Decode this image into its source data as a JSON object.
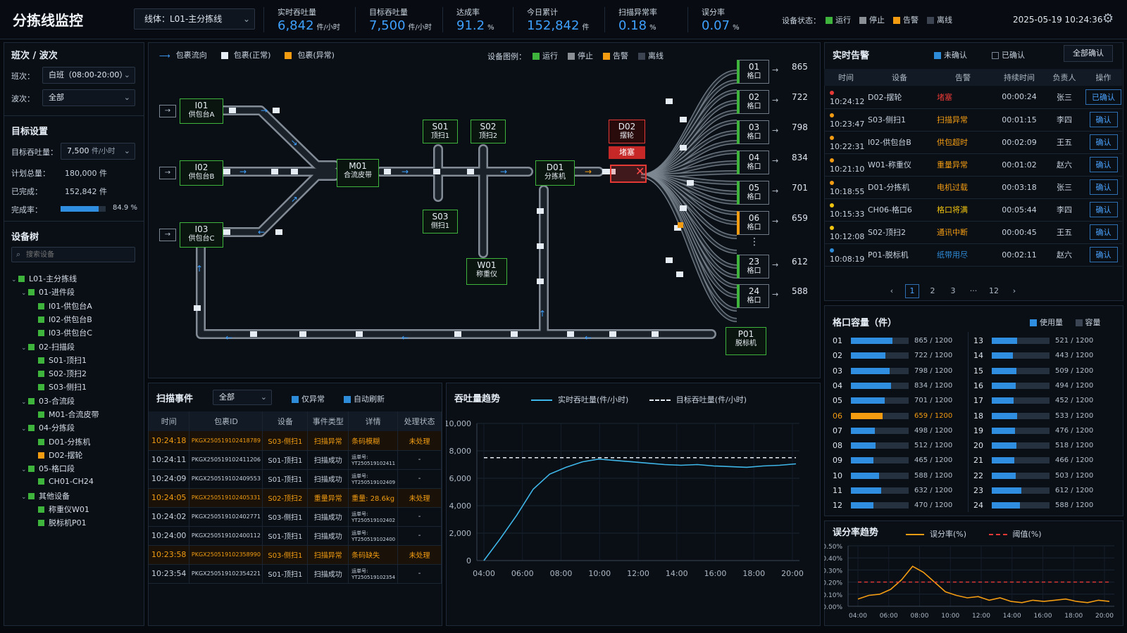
{
  "header": {
    "title": "分拣线监控",
    "line_select": "线体：L01-主分拣线",
    "datetime": "2025-05-19 10:24:36",
    "kpis": [
      {
        "label": "实时吞吐量",
        "value": "6,842",
        "unit": "件/小时"
      },
      {
        "label": "目标吞吐量",
        "value": "7,500",
        "unit": "件/小时"
      },
      {
        "label": "达成率",
        "value": "91.2",
        "unit": "%"
      },
      {
        "label": "今日累计",
        "value": "152,842",
        "unit": "件"
      },
      {
        "label": "扫描异常率",
        "value": "0.18",
        "unit": "%"
      },
      {
        "label": "误分率",
        "value": "0.07",
        "unit": "%"
      }
    ],
    "status_label": "设备状态：",
    "status": [
      {
        "label": "运行",
        "color": "#3eb43c"
      },
      {
        "label": "停止",
        "color": "#8a8f96"
      },
      {
        "label": "告警",
        "color": "#f39c12"
      },
      {
        "label": "离线",
        "color": "#3b4450"
      }
    ]
  },
  "left": {
    "shift_title": "班次 / 波次",
    "shift_label": "班次：",
    "shift_value": "白班（08:00-20:00）",
    "wave_label": "波次：",
    "wave_value": "全部",
    "target_title": "目标设置",
    "target_label": "目标吞吐量：",
    "target_value": "7,500",
    "target_unit": "件/小时",
    "plan_label": "计划总量：",
    "plan_value": "180,000 件",
    "done_label": "已完成：",
    "done_value": "152,842 件",
    "rate_label": "完成率：",
    "rate_value": "84.9 %",
    "rate": 0.849,
    "tree_title": "设备树",
    "search_placeholder": "搜索设备",
    "tree": [
      {
        "t": "L01-主分拣线",
        "lv": 0,
        "car": "⌄"
      },
      {
        "t": "01-进件段",
        "lv": 1,
        "car": "⌄"
      },
      {
        "t": "I01-供包台A",
        "lv": 2
      },
      {
        "t": "I02-供包台B",
        "lv": 2
      },
      {
        "t": "I03-供包台C",
        "lv": 2
      },
      {
        "t": "02-扫描段",
        "lv": 1,
        "car": "⌄"
      },
      {
        "t": "S01-顶扫1",
        "lv": 2
      },
      {
        "t": "S02-顶扫2",
        "lv": 2
      },
      {
        "t": "S03-侧扫1",
        "lv": 2
      },
      {
        "t": "03-合流段",
        "lv": 1,
        "car": "⌄"
      },
      {
        "t": "M01-合流皮带",
        "lv": 2
      },
      {
        "t": "04-分拣段",
        "lv": 1,
        "car": "⌄"
      },
      {
        "t": "D01-分拣机",
        "lv": 2
      },
      {
        "t": "D02-摆轮",
        "lv": 2,
        "warn": true
      },
      {
        "t": "05-格口段",
        "lv": 1,
        "car": "⌄"
      },
      {
        "t": "CH01-CH24",
        "lv": 2
      },
      {
        "t": "其他设备",
        "lv": 1,
        "car": "⌄"
      },
      {
        "t": "称重仪W01",
        "lv": 2
      },
      {
        "t": "脱标机P01",
        "lv": 2
      }
    ]
  },
  "flow": {
    "legend": [
      {
        "label": "包裹流向",
        "kind": "arrow"
      },
      {
        "label": "包裹(正常)",
        "kind": "white"
      },
      {
        "label": "包裹(异常)",
        "kind": "orange"
      }
    ],
    "dev_legend_label": "设备图例：",
    "dev_legend": [
      "运行",
      "停止",
      "告警",
      "离线"
    ],
    "nodes": [
      {
        "id": "I01",
        "name": "供包台A"
      },
      {
        "id": "I02",
        "name": "供包台B"
      },
      {
        "id": "I03",
        "name": "供包台C"
      },
      {
        "id": "M01",
        "name": "合流皮带"
      },
      {
        "id": "S01",
        "name": "顶扫1"
      },
      {
        "id": "S02",
        "name": "顶扫2"
      },
      {
        "id": "S03",
        "name": "侧扫1"
      },
      {
        "id": "W01",
        "name": "称重仪"
      },
      {
        "id": "D01",
        "name": "分拣机"
      },
      {
        "id": "D02",
        "name": "摆轮"
      },
      {
        "id": "P01",
        "name": "脱标机"
      }
    ],
    "jam_label": "堵塞",
    "chutes": [
      {
        "id": "01",
        "name": "格口",
        "count": "865"
      },
      {
        "id": "02",
        "name": "格口",
        "count": "722"
      },
      {
        "id": "03",
        "name": "格口",
        "count": "798"
      },
      {
        "id": "04",
        "name": "格口",
        "count": "834"
      },
      {
        "id": "05",
        "name": "格口",
        "count": "701"
      },
      {
        "id": "06",
        "name": "格口",
        "count": "659",
        "warn": true
      },
      {
        "id": "23",
        "name": "格口",
        "count": "612"
      },
      {
        "id": "24",
        "name": "格口",
        "count": "588"
      }
    ],
    "more": "⋮"
  },
  "alarms": {
    "title": "实时告警",
    "unack": "未确认",
    "ack": "已确认",
    "ack_all": "全部确认",
    "headers": [
      "时间",
      "设备",
      "告警",
      "持续时间",
      "负责人",
      "操作"
    ],
    "rows": [
      {
        "dot": "#e53935",
        "time": "10:24:12",
        "dev": "D02-摆轮",
        "alarm": "堵塞",
        "acolor": "#e53935",
        "dur": "00:00:24",
        "owner": "张三",
        "op": "已确认"
      },
      {
        "dot": "#f39c12",
        "time": "10:23:47",
        "dev": "S03-侧扫1",
        "alarm": "扫描异常",
        "acolor": "#f39c12",
        "dur": "00:01:15",
        "owner": "李四",
        "op": "确认"
      },
      {
        "dot": "#f39c12",
        "time": "10:22:31",
        "dev": "I02-供包台B",
        "alarm": "供包超时",
        "acolor": "#f39c12",
        "dur": "00:02:09",
        "owner": "王五",
        "op": "确认"
      },
      {
        "dot": "#f39c12",
        "time": "10:21:10",
        "dev": "W01-称重仪",
        "alarm": "重量异常",
        "acolor": "#f39c12",
        "dur": "00:01:02",
        "owner": "赵六",
        "op": "确认"
      },
      {
        "dot": "#f39c12",
        "time": "10:18:55",
        "dev": "D01-分拣机",
        "alarm": "电机过载",
        "acolor": "#f39c12",
        "dur": "00:03:18",
        "owner": "张三",
        "op": "确认"
      },
      {
        "dot": "#f1c40f",
        "time": "10:15:33",
        "dev": "CH06-格口6",
        "alarm": "格口将满",
        "acolor": "#f1c40f",
        "dur": "00:05:44",
        "owner": "李四",
        "op": "确认"
      },
      {
        "dot": "#f1c40f",
        "time": "10:12:08",
        "dev": "S02-顶扫2",
        "alarm": "通讯中断",
        "acolor": "#f39c12",
        "dur": "00:00:45",
        "owner": "王五",
        "op": "确认"
      },
      {
        "dot": "#2e8bd8",
        "time": "10:08:19",
        "dev": "P01-脱标机",
        "alarm": "纸带用尽",
        "acolor": "#2e8bd8",
        "dur": "00:02:11",
        "owner": "赵六",
        "op": "确认"
      }
    ],
    "pages": [
      "‹",
      "1",
      "2",
      "3",
      "···",
      "12",
      "›"
    ]
  },
  "capacity": {
    "title": "格口容量（件）",
    "used": "使用量",
    "cap": "容量",
    "rows": [
      {
        "id": "01",
        "used": 865,
        "text": "865 / 1200"
      },
      {
        "id": "02",
        "used": 722,
        "text": "722 / 1200"
      },
      {
        "id": "03",
        "used": 798,
        "text": "798 / 1200"
      },
      {
        "id": "04",
        "used": 834,
        "text": "834 / 1200"
      },
      {
        "id": "05",
        "used": 701,
        "text": "701 / 1200"
      },
      {
        "id": "06",
        "used": 659,
        "text": "659 / 1200",
        "warn": true
      },
      {
        "id": "07",
        "used": 498,
        "text": "498 / 1200"
      },
      {
        "id": "08",
        "used": 512,
        "text": "512 / 1200"
      },
      {
        "id": "09",
        "used": 465,
        "text": "465 / 1200"
      },
      {
        "id": "10",
        "used": 588,
        "text": "588 / 1200"
      },
      {
        "id": "11",
        "used": 632,
        "text": "632 / 1200"
      },
      {
        "id": "12",
        "used": 470,
        "text": "470 / 1200"
      },
      {
        "id": "13",
        "used": 521,
        "text": "521 / 1200"
      },
      {
        "id": "14",
        "used": 443,
        "text": "443 / 1200"
      },
      {
        "id": "15",
        "used": 509,
        "text": "509 / 1200"
      },
      {
        "id": "16",
        "used": 494,
        "text": "494 / 1200"
      },
      {
        "id": "17",
        "used": 452,
        "text": "452 / 1200"
      },
      {
        "id": "18",
        "used": 533,
        "text": "533 / 1200"
      },
      {
        "id": "19",
        "used": 476,
        "text": "476 / 1200"
      },
      {
        "id": "20",
        "used": 518,
        "text": "518 / 1200"
      },
      {
        "id": "21",
        "used": 466,
        "text": "466 / 1200"
      },
      {
        "id": "22",
        "used": 503,
        "text": "503 / 1200"
      },
      {
        "id": "23",
        "used": 612,
        "text": "612 / 1200"
      },
      {
        "id": "24",
        "used": 588,
        "text": "588 / 1200"
      }
    ],
    "max": 1200
  },
  "events": {
    "title": "扫描事件",
    "filter": "全部",
    "only_abn": "仅异常",
    "auto": "自动刷新",
    "headers": [
      "时间",
      "包裹ID",
      "设备",
      "事件类型",
      "详情",
      "处理状态"
    ],
    "rows": [
      {
        "abn": true,
        "time": "10:24:18",
        "pid": "PKGX250519102418789",
        "dev": "S03-侧扫1",
        "type": "扫描异常",
        "detail": "条码模糊",
        "detail2": "",
        "status": "未处理"
      },
      {
        "abn": false,
        "time": "10:24:11",
        "pid": "PKGX250519102411206",
        "dev": "S01-顶扫1",
        "type": "扫描成功",
        "detail": "运单号:",
        "detail2": "YT250519102411",
        "status": "-"
      },
      {
        "abn": false,
        "time": "10:24:09",
        "pid": "PKGX250519102409553",
        "dev": "S01-顶扫1",
        "type": "扫描成功",
        "detail": "运单号:",
        "detail2": "YT250519102409",
        "status": "-"
      },
      {
        "abn": true,
        "time": "10:24:05",
        "pid": "PKGX250519102405331",
        "dev": "S02-顶扫2",
        "type": "重量异常",
        "detail": "重量: 28.6kg",
        "detail2": "",
        "status": "未处理"
      },
      {
        "abn": false,
        "time": "10:24:02",
        "pid": "PKGX250519102402771",
        "dev": "S03-侧扫1",
        "type": "扫描成功",
        "detail": "运单号:",
        "detail2": "YT250519102402",
        "status": "-"
      },
      {
        "abn": false,
        "time": "10:24:00",
        "pid": "PKGX250519102400112",
        "dev": "S01-顶扫1",
        "type": "扫描成功",
        "detail": "运单号:",
        "detail2": "YT250519102400",
        "status": "-"
      },
      {
        "abn": true,
        "time": "10:23:58",
        "pid": "PKGX250519102358990",
        "dev": "S03-侧扫1",
        "type": "扫描异常",
        "detail": "条码缺失",
        "detail2": "",
        "status": "未处理"
      },
      {
        "abn": false,
        "time": "10:23:54",
        "pid": "PKGX250519102354221",
        "dev": "S01-顶扫1",
        "type": "扫描成功",
        "detail": "运单号:",
        "detail2": "YT250519102354",
        "status": "-"
      }
    ]
  },
  "chart_data": [
    {
      "type": "line",
      "title": "吞吐量趋势",
      "x": [
        "04:00",
        "06:00",
        "08:00",
        "10:00",
        "12:00",
        "14:00",
        "16:00",
        "18:00",
        "20:00"
      ],
      "ylim": [
        0,
        10000
      ],
      "yticks": [
        "10,000",
        "8,000",
        "6,000",
        "4,000",
        "2,000",
        "0"
      ],
      "series": [
        {
          "name": "实时吞吐量(件/小时)",
          "color": "#3fb6e8",
          "values": [
            0,
            1600,
            3300,
            5200,
            6300,
            6800,
            7200,
            7400,
            7300,
            7200,
            7100,
            7000,
            6950,
            7000,
            6900,
            6850,
            6800,
            6900,
            6950,
            7050
          ]
        },
        {
          "name": "目标吞吐量(件/小时)",
          "color": "#e6edf5",
          "dashed": true,
          "values": [
            7500
          ]
        }
      ]
    },
    {
      "type": "line",
      "title": "误分率趋势",
      "x": [
        "04:00",
        "06:00",
        "08:00",
        "10:00",
        "12:00",
        "14:00",
        "16:00",
        "18:00",
        "20:00"
      ],
      "ylim": [
        0,
        0.5
      ],
      "yticks": [
        "0.50%",
        "0.40%",
        "0.30%",
        "0.20%",
        "0.10%",
        "0.00%"
      ],
      "series": [
        {
          "name": "误分率(%)",
          "color": "#f39c12",
          "values": [
            0.06,
            0.09,
            0.1,
            0.14,
            0.22,
            0.33,
            0.28,
            0.2,
            0.12,
            0.09,
            0.07,
            0.08,
            0.05,
            0.07,
            0.04,
            0.03,
            0.05,
            0.04,
            0.05,
            0.06,
            0.04,
            0.03,
            0.05,
            0.04
          ]
        },
        {
          "name": "阈值(%)",
          "color": "#e53935",
          "dashed": true,
          "values": [
            0.2
          ]
        }
      ]
    }
  ]
}
